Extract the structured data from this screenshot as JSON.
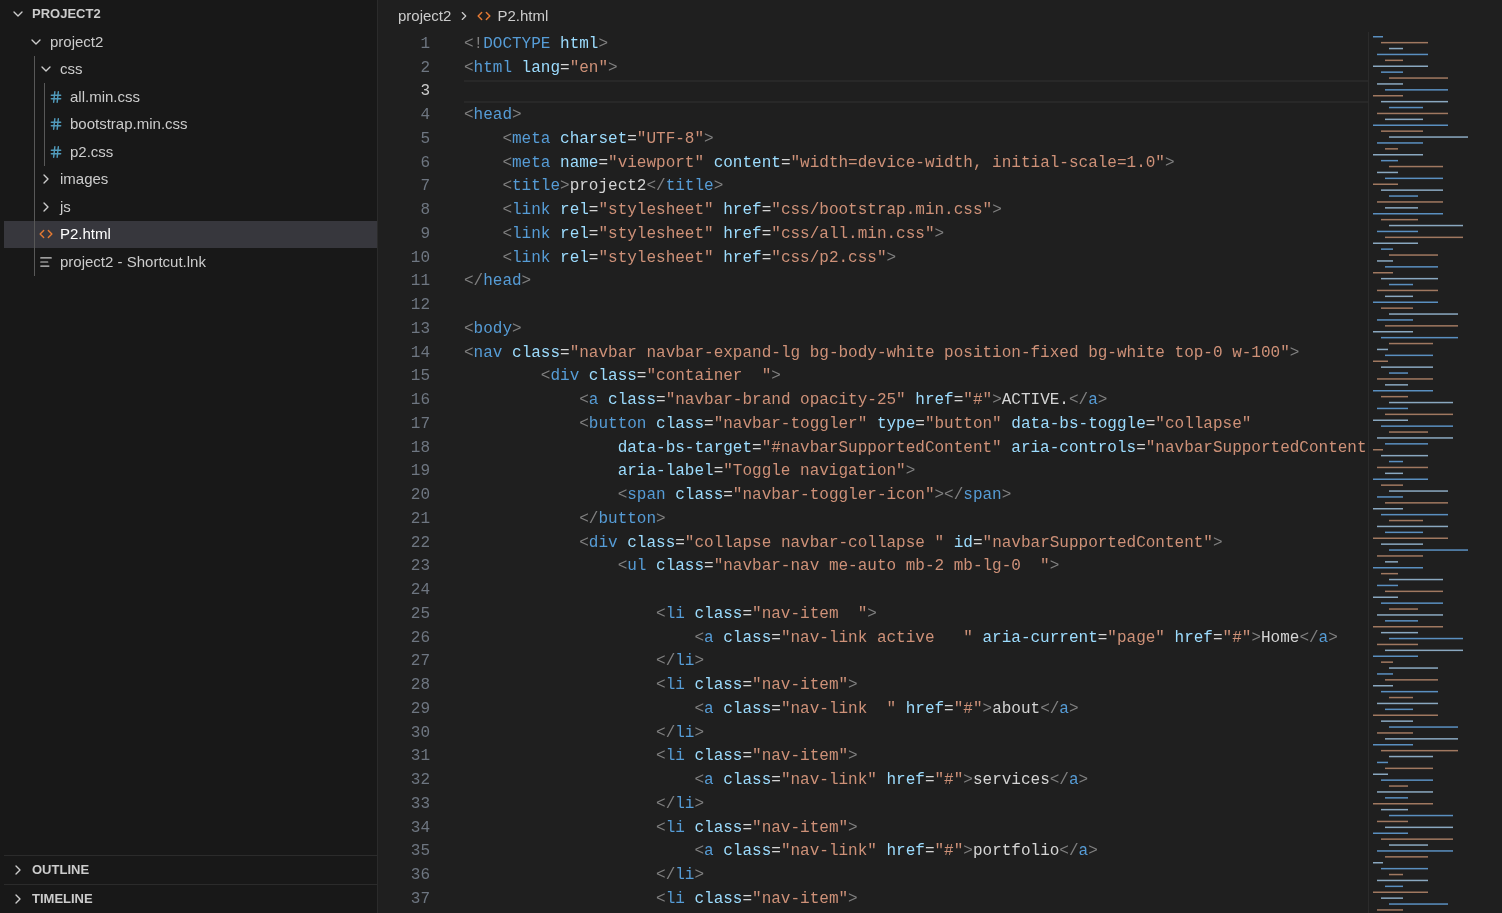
{
  "sidebar": {
    "sections": [
      {
        "label": "PROJECT2",
        "expanded": true,
        "tree": [
          {
            "name": "project2",
            "kind": "folder",
            "expanded": true,
            "selected": false,
            "children": [
              {
                "name": "css",
                "kind": "folder",
                "expanded": true,
                "selected": false,
                "children": [
                  {
                    "name": "all.min.css",
                    "kind": "css",
                    "selected": false
                  },
                  {
                    "name": "bootstrap.min.css",
                    "kind": "css",
                    "selected": false
                  },
                  {
                    "name": "p2.css",
                    "kind": "css",
                    "selected": false
                  }
                ]
              },
              {
                "name": "images",
                "kind": "folder",
                "expanded": false,
                "selected": false
              },
              {
                "name": "js",
                "kind": "folder",
                "expanded": false,
                "selected": false
              },
              {
                "name": "P2.html",
                "kind": "html",
                "selected": true
              },
              {
                "name": "project2 - Shortcut.lnk",
                "kind": "file",
                "selected": false
              }
            ]
          }
        ]
      },
      {
        "label": "OUTLINE",
        "expanded": false
      },
      {
        "label": "TIMELINE",
        "expanded": false
      }
    ]
  },
  "breadcrumb": [
    {
      "label": "project2",
      "kind": "folder"
    },
    {
      "label": "P2.html",
      "kind": "html"
    }
  ],
  "editor": {
    "lines": [
      {
        "n": "1",
        "current": false,
        "t": [
          {
            "kind": "p",
            "text": "<!"
          },
          {
            "kind": "tag",
            "text": "DOCTYPE"
          },
          {
            "kind": "attr",
            "text": " html"
          },
          {
            "kind": "p",
            "text": ">"
          }
        ]
      },
      {
        "n": "2",
        "current": false,
        "t": [
          {
            "kind": "p",
            "text": "<"
          },
          {
            "kind": "tag",
            "text": "html"
          },
          {
            "kind": "attr",
            "text": " lang"
          },
          {
            "kind": "txt",
            "text": "="
          },
          {
            "kind": "str",
            "text": "\"en\""
          },
          {
            "kind": "p",
            "text": ">"
          }
        ]
      },
      {
        "n": "3",
        "current": true
      },
      {
        "n": "4",
        "current": false,
        "t": [
          {
            "kind": "p",
            "text": "<"
          },
          {
            "kind": "tag",
            "text": "head"
          },
          {
            "kind": "p",
            "text": ">"
          }
        ]
      },
      {
        "n": "5",
        "current": false,
        "t": [
          {
            "kind": "p",
            "text": "    <"
          },
          {
            "kind": "tag",
            "text": "meta"
          },
          {
            "kind": "attr",
            "text": " charset"
          },
          {
            "kind": "txt",
            "text": "="
          },
          {
            "kind": "str",
            "text": "\"UTF-8\""
          },
          {
            "kind": "p",
            "text": ">"
          }
        ]
      },
      {
        "n": "6",
        "current": false,
        "t": [
          {
            "kind": "p",
            "text": "    <"
          },
          {
            "kind": "tag",
            "text": "meta"
          },
          {
            "kind": "attr",
            "text": " name"
          },
          {
            "kind": "txt",
            "text": "="
          },
          {
            "kind": "str",
            "text": "\"viewport\""
          },
          {
            "kind": "attr",
            "text": " content"
          },
          {
            "kind": "txt",
            "text": "="
          },
          {
            "kind": "str",
            "text": "\"width=device-width, initial-scale=1.0\""
          },
          {
            "kind": "p",
            "text": ">"
          }
        ]
      },
      {
        "n": "7",
        "current": false,
        "t": [
          {
            "kind": "p",
            "text": "    <"
          },
          {
            "kind": "tag",
            "text": "title"
          },
          {
            "kind": "p",
            "text": ">"
          },
          {
            "kind": "txt",
            "text": "project2"
          },
          {
            "kind": "p",
            "text": "</"
          },
          {
            "kind": "tag",
            "text": "title"
          },
          {
            "kind": "p",
            "text": ">"
          }
        ]
      },
      {
        "n": "8",
        "current": false,
        "t": [
          {
            "kind": "p",
            "text": "    <"
          },
          {
            "kind": "tag",
            "text": "link"
          },
          {
            "kind": "attr",
            "text": " rel"
          },
          {
            "kind": "txt",
            "text": "="
          },
          {
            "kind": "str",
            "text": "\"stylesheet\""
          },
          {
            "kind": "attr",
            "text": " href"
          },
          {
            "kind": "txt",
            "text": "="
          },
          {
            "kind": "str",
            "text": "\"css/bootstrap.min.css\""
          },
          {
            "kind": "p",
            "text": ">"
          }
        ]
      },
      {
        "n": "9",
        "current": false,
        "t": [
          {
            "kind": "p",
            "text": "    <"
          },
          {
            "kind": "tag",
            "text": "link"
          },
          {
            "kind": "attr",
            "text": " rel"
          },
          {
            "kind": "txt",
            "text": "="
          },
          {
            "kind": "str",
            "text": "\"stylesheet\""
          },
          {
            "kind": "attr",
            "text": " href"
          },
          {
            "kind": "txt",
            "text": "="
          },
          {
            "kind": "str",
            "text": "\"css/all.min.css\""
          },
          {
            "kind": "p",
            "text": ">"
          }
        ]
      },
      {
        "n": "10",
        "current": false,
        "t": [
          {
            "kind": "p",
            "text": "    <"
          },
          {
            "kind": "tag",
            "text": "link"
          },
          {
            "kind": "attr",
            "text": " rel"
          },
          {
            "kind": "txt",
            "text": "="
          },
          {
            "kind": "str",
            "text": "\"stylesheet\""
          },
          {
            "kind": "attr",
            "text": " href"
          },
          {
            "kind": "txt",
            "text": "="
          },
          {
            "kind": "str",
            "text": "\"css/p2.css\""
          },
          {
            "kind": "p",
            "text": ">"
          }
        ]
      },
      {
        "n": "11",
        "current": false,
        "t": [
          {
            "kind": "p",
            "text": "</"
          },
          {
            "kind": "tag",
            "text": "head"
          },
          {
            "kind": "p",
            "text": ">"
          }
        ]
      },
      {
        "n": "12",
        "current": false
      },
      {
        "n": "13",
        "current": false,
        "t": [
          {
            "kind": "p",
            "text": "<"
          },
          {
            "kind": "tag",
            "text": "body"
          },
          {
            "kind": "p",
            "text": ">"
          }
        ]
      },
      {
        "n": "14",
        "current": false,
        "t": [
          {
            "kind": "p",
            "text": "<"
          },
          {
            "kind": "tag",
            "text": "nav"
          },
          {
            "kind": "attr",
            "text": " class"
          },
          {
            "kind": "txt",
            "text": "="
          },
          {
            "kind": "str",
            "text": "\"navbar navbar-expand-lg bg-body-white position-fixed bg-white top-0 w-100\""
          },
          {
            "kind": "p",
            "text": ">"
          }
        ]
      },
      {
        "n": "15",
        "current": false,
        "t": [
          {
            "kind": "p",
            "text": "        <"
          },
          {
            "kind": "tag",
            "text": "div"
          },
          {
            "kind": "attr",
            "text": " class"
          },
          {
            "kind": "txt",
            "text": "="
          },
          {
            "kind": "str",
            "text": "\"container  \""
          },
          {
            "kind": "p",
            "text": ">"
          }
        ]
      },
      {
        "n": "16",
        "current": false,
        "t": [
          {
            "kind": "p",
            "text": "            <"
          },
          {
            "kind": "tag",
            "text": "a"
          },
          {
            "kind": "attr",
            "text": " class"
          },
          {
            "kind": "txt",
            "text": "="
          },
          {
            "kind": "str",
            "text": "\"navbar-brand opacity-25\""
          },
          {
            "kind": "attr",
            "text": " href"
          },
          {
            "kind": "txt",
            "text": "="
          },
          {
            "kind": "str",
            "text": "\"#\""
          },
          {
            "kind": "p",
            "text": ">"
          },
          {
            "kind": "txt",
            "text": "ACTIVE."
          },
          {
            "kind": "p",
            "text": "</"
          },
          {
            "kind": "tag",
            "text": "a"
          },
          {
            "kind": "p",
            "text": ">"
          }
        ]
      },
      {
        "n": "17",
        "current": false,
        "t": [
          {
            "kind": "p",
            "text": "            <"
          },
          {
            "kind": "tag",
            "text": "button"
          },
          {
            "kind": "attr",
            "text": " class"
          },
          {
            "kind": "txt",
            "text": "="
          },
          {
            "kind": "str",
            "text": "\"navbar-toggler\""
          },
          {
            "kind": "attr",
            "text": " type"
          },
          {
            "kind": "txt",
            "text": "="
          },
          {
            "kind": "str",
            "text": "\"button\""
          },
          {
            "kind": "attr",
            "text": " data-bs-toggle"
          },
          {
            "kind": "txt",
            "text": "="
          },
          {
            "kind": "str",
            "text": "\"collapse\""
          }
        ]
      },
      {
        "n": "18",
        "current": false,
        "t": [
          {
            "kind": "attr",
            "text": "                data-bs-target"
          },
          {
            "kind": "txt",
            "text": "="
          },
          {
            "kind": "str",
            "text": "\"#navbarSupportedContent\""
          },
          {
            "kind": "attr",
            "text": " aria-controls"
          },
          {
            "kind": "txt",
            "text": "="
          },
          {
            "kind": "str",
            "text": "\"navbarSupportedContent"
          }
        ]
      },
      {
        "n": "19",
        "current": false,
        "t": [
          {
            "kind": "attr",
            "text": "                aria-label"
          },
          {
            "kind": "txt",
            "text": "="
          },
          {
            "kind": "str",
            "text": "\"Toggle navigation\""
          },
          {
            "kind": "p",
            "text": ">"
          }
        ]
      },
      {
        "n": "20",
        "current": false,
        "t": [
          {
            "kind": "p",
            "text": "                <"
          },
          {
            "kind": "tag",
            "text": "span"
          },
          {
            "kind": "attr",
            "text": " class"
          },
          {
            "kind": "txt",
            "text": "="
          },
          {
            "kind": "str",
            "text": "\"navbar-toggler-icon\""
          },
          {
            "kind": "p",
            "text": "></"
          },
          {
            "kind": "tag",
            "text": "span"
          },
          {
            "kind": "p",
            "text": ">"
          }
        ]
      },
      {
        "n": "21",
        "current": false,
        "t": [
          {
            "kind": "p",
            "text": "            </"
          },
          {
            "kind": "tag",
            "text": "button"
          },
          {
            "kind": "p",
            "text": ">"
          }
        ]
      },
      {
        "n": "22",
        "current": false,
        "t": [
          {
            "kind": "p",
            "text": "            <"
          },
          {
            "kind": "tag",
            "text": "div"
          },
          {
            "kind": "attr",
            "text": " class"
          },
          {
            "kind": "txt",
            "text": "="
          },
          {
            "kind": "str",
            "text": "\"collapse navbar-collapse \""
          },
          {
            "kind": "attr",
            "text": " id"
          },
          {
            "kind": "txt",
            "text": "="
          },
          {
            "kind": "str",
            "text": "\"navbarSupportedContent\""
          },
          {
            "kind": "p",
            "text": ">"
          }
        ]
      },
      {
        "n": "23",
        "current": false,
        "t": [
          {
            "kind": "p",
            "text": "                <"
          },
          {
            "kind": "tag",
            "text": "ul"
          },
          {
            "kind": "attr",
            "text": " class"
          },
          {
            "kind": "txt",
            "text": "="
          },
          {
            "kind": "str",
            "text": "\"navbar-nav me-auto mb-2 mb-lg-0  \""
          },
          {
            "kind": "p",
            "text": ">"
          }
        ]
      },
      {
        "n": "24",
        "current": false
      },
      {
        "n": "25",
        "current": false,
        "t": [
          {
            "kind": "p",
            "text": "                    <"
          },
          {
            "kind": "tag",
            "text": "li"
          },
          {
            "kind": "attr",
            "text": " class"
          },
          {
            "kind": "txt",
            "text": "="
          },
          {
            "kind": "str",
            "text": "\"nav-item  \""
          },
          {
            "kind": "p",
            "text": ">"
          }
        ]
      },
      {
        "n": "26",
        "current": false,
        "t": [
          {
            "kind": "p",
            "text": "                        <"
          },
          {
            "kind": "tag",
            "text": "a"
          },
          {
            "kind": "attr",
            "text": " class"
          },
          {
            "kind": "txt",
            "text": "="
          },
          {
            "kind": "str",
            "text": "\"nav-link active   \""
          },
          {
            "kind": "attr",
            "text": " aria-current"
          },
          {
            "kind": "txt",
            "text": "="
          },
          {
            "kind": "str",
            "text": "\"page\""
          },
          {
            "kind": "attr",
            "text": " href"
          },
          {
            "kind": "txt",
            "text": "="
          },
          {
            "kind": "str",
            "text": "\"#\""
          },
          {
            "kind": "p",
            "text": ">"
          },
          {
            "kind": "txt",
            "text": "Home"
          },
          {
            "kind": "p",
            "text": "</"
          },
          {
            "kind": "tag",
            "text": "a"
          },
          {
            "kind": "p",
            "text": ">"
          }
        ]
      },
      {
        "n": "27",
        "current": false,
        "t": [
          {
            "kind": "p",
            "text": "                    </"
          },
          {
            "kind": "tag",
            "text": "li"
          },
          {
            "kind": "p",
            "text": ">"
          }
        ]
      },
      {
        "n": "28",
        "current": false,
        "t": [
          {
            "kind": "p",
            "text": "                    <"
          },
          {
            "kind": "tag",
            "text": "li"
          },
          {
            "kind": "attr",
            "text": " class"
          },
          {
            "kind": "txt",
            "text": "="
          },
          {
            "kind": "str",
            "text": "\"nav-item\""
          },
          {
            "kind": "p",
            "text": ">"
          }
        ]
      },
      {
        "n": "29",
        "current": false,
        "t": [
          {
            "kind": "p",
            "text": "                        <"
          },
          {
            "kind": "tag",
            "text": "a"
          },
          {
            "kind": "attr",
            "text": " class"
          },
          {
            "kind": "txt",
            "text": "="
          },
          {
            "kind": "str",
            "text": "\"nav-link  \""
          },
          {
            "kind": "attr",
            "text": " href"
          },
          {
            "kind": "txt",
            "text": "="
          },
          {
            "kind": "str",
            "text": "\"#\""
          },
          {
            "kind": "p",
            "text": ">"
          },
          {
            "kind": "txt",
            "text": "about"
          },
          {
            "kind": "p",
            "text": "</"
          },
          {
            "kind": "tag",
            "text": "a"
          },
          {
            "kind": "p",
            "text": ">"
          }
        ]
      },
      {
        "n": "30",
        "current": false,
        "t": [
          {
            "kind": "p",
            "text": "                    </"
          },
          {
            "kind": "tag",
            "text": "li"
          },
          {
            "kind": "p",
            "text": ">"
          }
        ]
      },
      {
        "n": "31",
        "current": false,
        "t": [
          {
            "kind": "p",
            "text": "                    <"
          },
          {
            "kind": "tag",
            "text": "li"
          },
          {
            "kind": "attr",
            "text": " class"
          },
          {
            "kind": "txt",
            "text": "="
          },
          {
            "kind": "str",
            "text": "\"nav-item\""
          },
          {
            "kind": "p",
            "text": ">"
          }
        ]
      },
      {
        "n": "32",
        "current": false,
        "t": [
          {
            "kind": "p",
            "text": "                        <"
          },
          {
            "kind": "tag",
            "text": "a"
          },
          {
            "kind": "attr",
            "text": " class"
          },
          {
            "kind": "txt",
            "text": "="
          },
          {
            "kind": "str",
            "text": "\"nav-link\""
          },
          {
            "kind": "attr",
            "text": " href"
          },
          {
            "kind": "txt",
            "text": "="
          },
          {
            "kind": "str",
            "text": "\"#\""
          },
          {
            "kind": "p",
            "text": ">"
          },
          {
            "kind": "txt",
            "text": "services"
          },
          {
            "kind": "p",
            "text": "</"
          },
          {
            "kind": "tag",
            "text": "a"
          },
          {
            "kind": "p",
            "text": ">"
          }
        ]
      },
      {
        "n": "33",
        "current": false,
        "t": [
          {
            "kind": "p",
            "text": "                    </"
          },
          {
            "kind": "tag",
            "text": "li"
          },
          {
            "kind": "p",
            "text": ">"
          }
        ]
      },
      {
        "n": "34",
        "current": false,
        "t": [
          {
            "kind": "p",
            "text": "                    <"
          },
          {
            "kind": "tag",
            "text": "li"
          },
          {
            "kind": "attr",
            "text": " class"
          },
          {
            "kind": "txt",
            "text": "="
          },
          {
            "kind": "str",
            "text": "\"nav-item\""
          },
          {
            "kind": "p",
            "text": ">"
          }
        ]
      },
      {
        "n": "35",
        "current": false,
        "t": [
          {
            "kind": "p",
            "text": "                        <"
          },
          {
            "kind": "tag",
            "text": "a"
          },
          {
            "kind": "attr",
            "text": " class"
          },
          {
            "kind": "txt",
            "text": "="
          },
          {
            "kind": "str",
            "text": "\"nav-link\""
          },
          {
            "kind": "attr",
            "text": " href"
          },
          {
            "kind": "txt",
            "text": "="
          },
          {
            "kind": "str",
            "text": "\"#\""
          },
          {
            "kind": "p",
            "text": ">"
          },
          {
            "kind": "txt",
            "text": "portfolio"
          },
          {
            "kind": "p",
            "text": "</"
          },
          {
            "kind": "tag",
            "text": "a"
          },
          {
            "kind": "p",
            "text": ">"
          }
        ]
      },
      {
        "n": "36",
        "current": false,
        "t": [
          {
            "kind": "p",
            "text": "                    </"
          },
          {
            "kind": "tag",
            "text": "li"
          },
          {
            "kind": "p",
            "text": ">"
          }
        ]
      },
      {
        "n": "37",
        "current": false,
        "t": [
          {
            "kind": "p",
            "text": "                    <"
          },
          {
            "kind": "tag",
            "text": "li"
          },
          {
            "kind": "attr",
            "text": " class"
          },
          {
            "kind": "txt",
            "text": "="
          },
          {
            "kind": "str",
            "text": "\"nav-item\""
          },
          {
            "kind": "p",
            "text": ">"
          }
        ]
      }
    ]
  }
}
